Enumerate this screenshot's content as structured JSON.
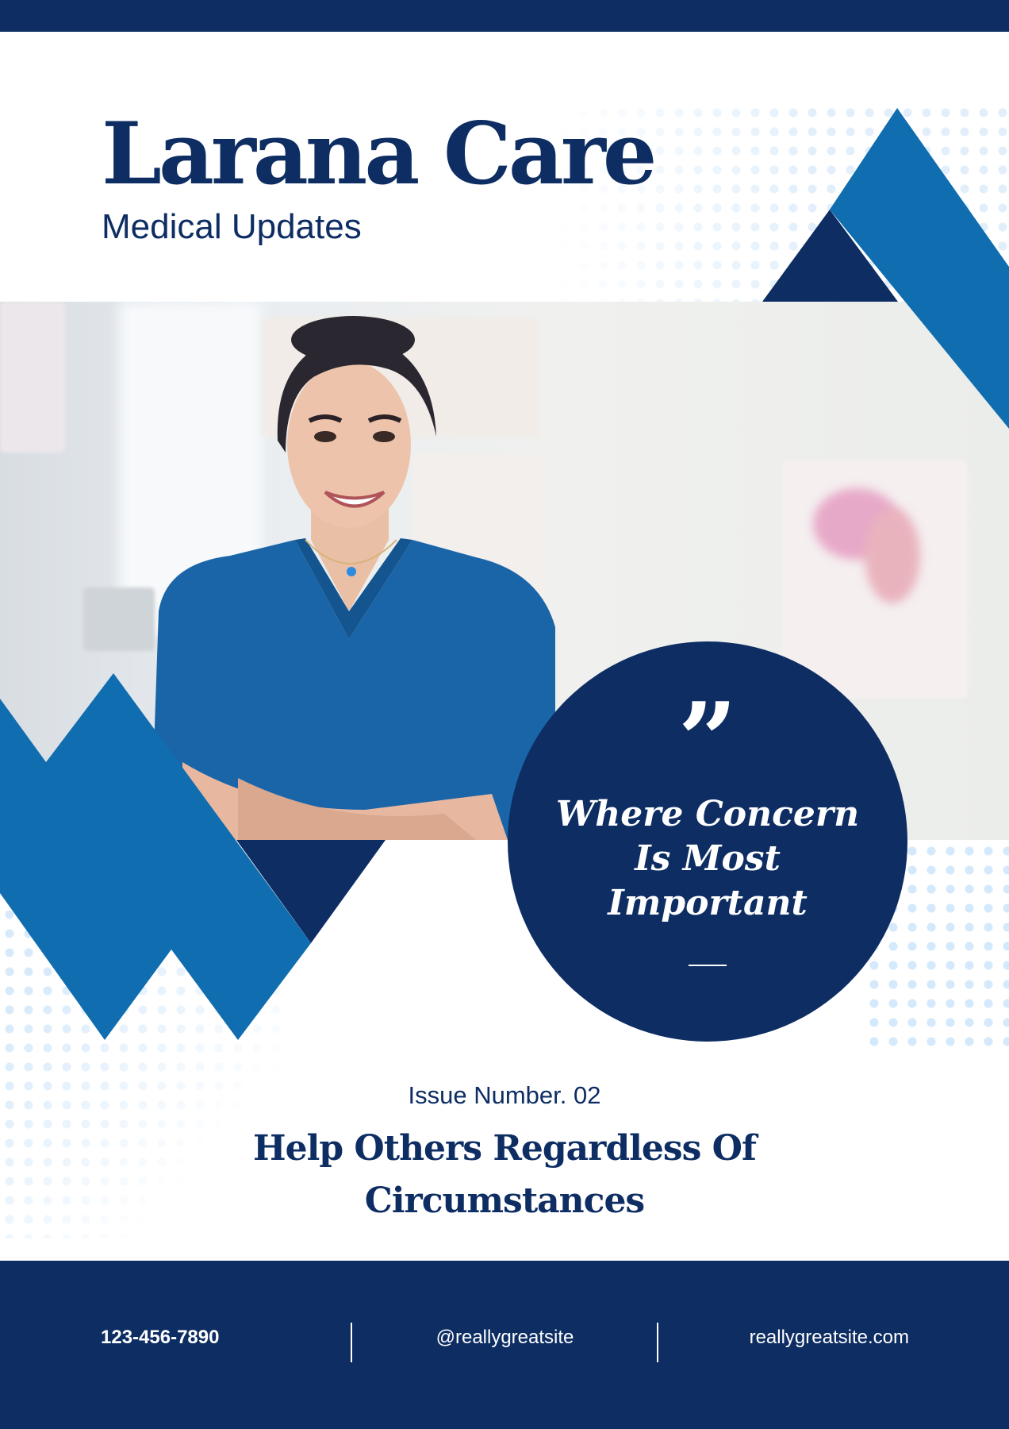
{
  "brand": {
    "title": "Larana Care",
    "subtitle": "Medical Updates"
  },
  "hero": {
    "photo_alt": "Smiling nurse in blue scrubs with arms crossed in a clinic"
  },
  "quote": {
    "mark": "”",
    "text": "Where Concern Is Most Important"
  },
  "issue": {
    "label": "Issue Number. 02",
    "headline": "Help Others Regardless Of Circumstances"
  },
  "footer": {
    "phone": "123-456-7890",
    "social": "@reallygreatsite",
    "website": "reallygreatsite.com"
  },
  "colors": {
    "navy": "#0d2d63",
    "accent_blue": "#0f6db0",
    "scrubs": "#1a65a8",
    "dot_tint": "#cfe6fa"
  }
}
